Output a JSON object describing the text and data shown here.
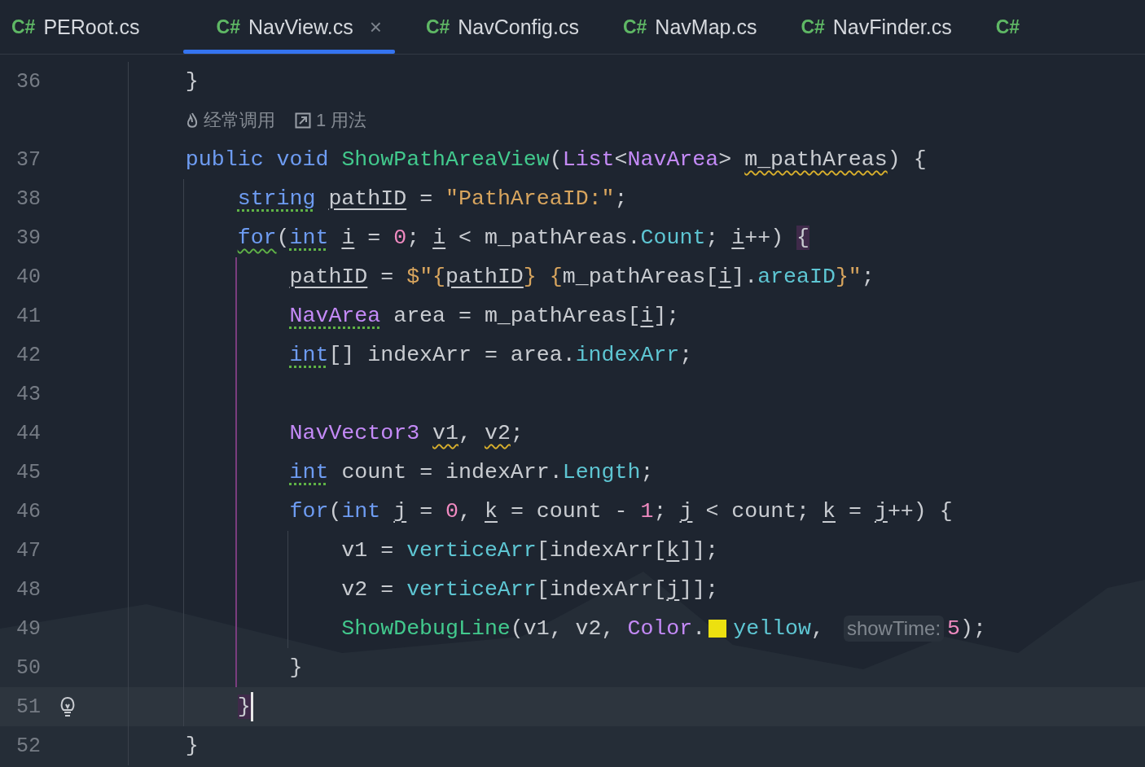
{
  "tabs": [
    {
      "lang": "C#",
      "label": "PERoot.cs",
      "selected": false
    },
    {
      "lang": "C#",
      "label": "NavView.cs",
      "selected": true,
      "close": "×"
    },
    {
      "lang": "C#",
      "label": "NavConfig.cs",
      "selected": false
    },
    {
      "lang": "C#",
      "label": "NavMap.cs",
      "selected": false
    },
    {
      "lang": "C#",
      "label": "NavFinder.cs",
      "selected": false
    },
    {
      "lang": "C#",
      "selected": false
    }
  ],
  "lines": [
    {
      "kind": "code",
      "number": "36",
      "tokens": [
        {
          "text": "    }",
          "kind": "plain"
        }
      ]
    },
    {
      "kind": "vision",
      "items": [
        {
          "text": "经常调用"
        },
        {
          "text": "1 用法"
        }
      ]
    },
    {
      "kind": "code",
      "number": "37",
      "tokens": [
        {
          "text": "    public ",
          "kind": "keyword"
        },
        {
          "text": "void ",
          "kind": "keyword"
        },
        {
          "text": "ShowPathAreaView",
          "kind": "func"
        },
        {
          "text": "(",
          "kind": "plain"
        },
        {
          "text": "List",
          "kind": "type"
        },
        {
          "text": "<",
          "kind": "plain"
        },
        {
          "text": "NavArea",
          "kind": "type"
        },
        {
          "text": "> ",
          "kind": "plain"
        },
        {
          "text": "m_pathAreas",
          "kind": "plain",
          "warning": true
        },
        {
          "text": ") {",
          "kind": "plain"
        }
      ]
    },
    {
      "kind": "code",
      "number": "38",
      "tokens": [
        {
          "text": "        string ",
          "kind": "keyword",
          "suggestion": true
        },
        {
          "text": "pathID",
          "kind": "plain",
          "underlined": true
        },
        {
          "text": " = ",
          "kind": "plain"
        },
        {
          "text": "\"PathAreaID:\"",
          "kind": "string"
        },
        {
          "text": ";",
          "kind": "plain"
        }
      ]
    },
    {
      "kind": "code",
      "number": "39",
      "tokens": [
        {
          "text": "        for",
          "kind": "keyword",
          "typo": true
        },
        {
          "text": "(",
          "kind": "plain"
        },
        {
          "text": "int ",
          "kind": "keyword",
          "suggestion": true
        },
        {
          "text": "i",
          "kind": "plain",
          "underlined": true
        },
        {
          "text": " = ",
          "kind": "plain"
        },
        {
          "text": "0",
          "kind": "number"
        },
        {
          "text": "; ",
          "kind": "plain"
        },
        {
          "text": "i",
          "kind": "plain",
          "underlined": true
        },
        {
          "text": " < m_pathAreas.",
          "kind": "plain"
        },
        {
          "text": "Count",
          "kind": "member"
        },
        {
          "text": "; ",
          "kind": "plain"
        },
        {
          "text": "i",
          "kind": "plain",
          "underlined": true
        },
        {
          "text": "++) ",
          "kind": "plain"
        },
        {
          "text": "{",
          "kind": "plain",
          "matched": true
        }
      ]
    },
    {
      "kind": "code",
      "number": "40",
      "tokens": [
        {
          "text": "            pathID",
          "kind": "plain",
          "underlined": true
        },
        {
          "text": " = ",
          "kind": "plain"
        },
        {
          "text": "$\"{",
          "kind": "string"
        },
        {
          "text": "pathID",
          "kind": "plain",
          "underlined": true
        },
        {
          "text": "} {",
          "kind": "string"
        },
        {
          "text": "m_pathAreas[",
          "kind": "plain"
        },
        {
          "text": "i",
          "kind": "plain",
          "underlined": true
        },
        {
          "text": "].",
          "kind": "plain"
        },
        {
          "text": "areaID",
          "kind": "member"
        },
        {
          "text": "}\"",
          "kind": "string"
        },
        {
          "text": ";",
          "kind": "plain"
        }
      ]
    },
    {
      "kind": "code",
      "number": "41",
      "tokens": [
        {
          "text": "            NavArea",
          "kind": "type",
          "suggestion": true
        },
        {
          "text": " area = m_pathAreas[",
          "kind": "plain"
        },
        {
          "text": "i",
          "kind": "plain",
          "underlined": true
        },
        {
          "text": "];",
          "kind": "plain"
        }
      ]
    },
    {
      "kind": "code",
      "number": "42",
      "tokens": [
        {
          "text": "            int",
          "kind": "keyword",
          "suggestion": true
        },
        {
          "text": "[] indexArr = area.",
          "kind": "plain"
        },
        {
          "text": "indexArr",
          "kind": "member"
        },
        {
          "text": ";",
          "kind": "plain"
        }
      ]
    },
    {
      "kind": "code",
      "number": "43"
    },
    {
      "kind": "code",
      "number": "44",
      "tokens": [
        {
          "text": "            NavVector3 ",
          "kind": "type"
        },
        {
          "text": "v1",
          "kind": "plain",
          "warning": true
        },
        {
          "text": ", ",
          "kind": "plain"
        },
        {
          "text": "v2",
          "kind": "plain",
          "warning": true
        },
        {
          "text": ";",
          "kind": "plain"
        }
      ]
    },
    {
      "kind": "code",
      "number": "45",
      "tokens": [
        {
          "text": "            int",
          "kind": "keyword",
          "suggestion": true
        },
        {
          "text": " count = indexArr.",
          "kind": "plain"
        },
        {
          "text": "Length",
          "kind": "member"
        },
        {
          "text": ";",
          "kind": "plain"
        }
      ]
    },
    {
      "kind": "code",
      "number": "46",
      "tokens": [
        {
          "text": "            for",
          "kind": "keyword"
        },
        {
          "text": "(",
          "kind": "plain"
        },
        {
          "text": "int ",
          "kind": "keyword"
        },
        {
          "text": "j",
          "kind": "plain",
          "underlined": true
        },
        {
          "text": " = ",
          "kind": "plain"
        },
        {
          "text": "0",
          "kind": "number"
        },
        {
          "text": ", ",
          "kind": "plain"
        },
        {
          "text": "k",
          "kind": "plain",
          "underlined": true
        },
        {
          "text": " = count - ",
          "kind": "plain"
        },
        {
          "text": "1",
          "kind": "number"
        },
        {
          "text": "; ",
          "kind": "plain"
        },
        {
          "text": "j",
          "kind": "plain",
          "underlined": true
        },
        {
          "text": " < count; ",
          "kind": "plain"
        },
        {
          "text": "k",
          "kind": "plain",
          "underlined": true
        },
        {
          "text": " = ",
          "kind": "plain"
        },
        {
          "text": "j",
          "kind": "plain",
          "underlined": true
        },
        {
          "text": "++) {",
          "kind": "plain"
        }
      ]
    },
    {
      "kind": "code",
      "number": "47",
      "tokens": [
        {
          "text": "                v1 = ",
          "kind": "plain"
        },
        {
          "text": "verticeArr",
          "kind": "member"
        },
        {
          "text": "[indexArr[",
          "kind": "plain"
        },
        {
          "text": "k",
          "kind": "plain",
          "underlined": true
        },
        {
          "text": "]];",
          "kind": "plain"
        }
      ]
    },
    {
      "kind": "code",
      "number": "48",
      "tokens": [
        {
          "text": "                v2 = ",
          "kind": "plain"
        },
        {
          "text": "verticeArr",
          "kind": "member"
        },
        {
          "text": "[indexArr[",
          "kind": "plain"
        },
        {
          "text": "j",
          "kind": "plain",
          "underlined": true
        },
        {
          "text": "]];",
          "kind": "plain"
        }
      ]
    },
    {
      "kind": "code",
      "number": "49",
      "tokens": [
        {
          "text": "                ShowDebugLine",
          "kind": "func"
        },
        {
          "text": "(v1, v2, ",
          "kind": "plain"
        },
        {
          "text": "Color",
          "kind": "type"
        },
        {
          "text": ".",
          "kind": "plain"
        },
        {
          "kind": "swatch",
          "color": "#ece010"
        },
        {
          "text": "yellow",
          "kind": "member"
        },
        {
          "text": ", ",
          "kind": "plain"
        },
        {
          "text": "showTime:",
          "kind": "hint"
        },
        {
          "text": "5",
          "kind": "number"
        },
        {
          "text": ");",
          "kind": "plain"
        }
      ]
    },
    {
      "kind": "code",
      "number": "50",
      "tokens": [
        {
          "text": "            }",
          "kind": "plain"
        }
      ]
    },
    {
      "kind": "code",
      "number": "51",
      "bulb": true,
      "caret": true,
      "tokens": [
        {
          "text": "        }",
          "kind": "plain",
          "matched": true
        }
      ]
    },
    {
      "kind": "code",
      "number": "52",
      "tokens": [
        {
          "text": "    }",
          "kind": "plain"
        }
      ]
    }
  ]
}
